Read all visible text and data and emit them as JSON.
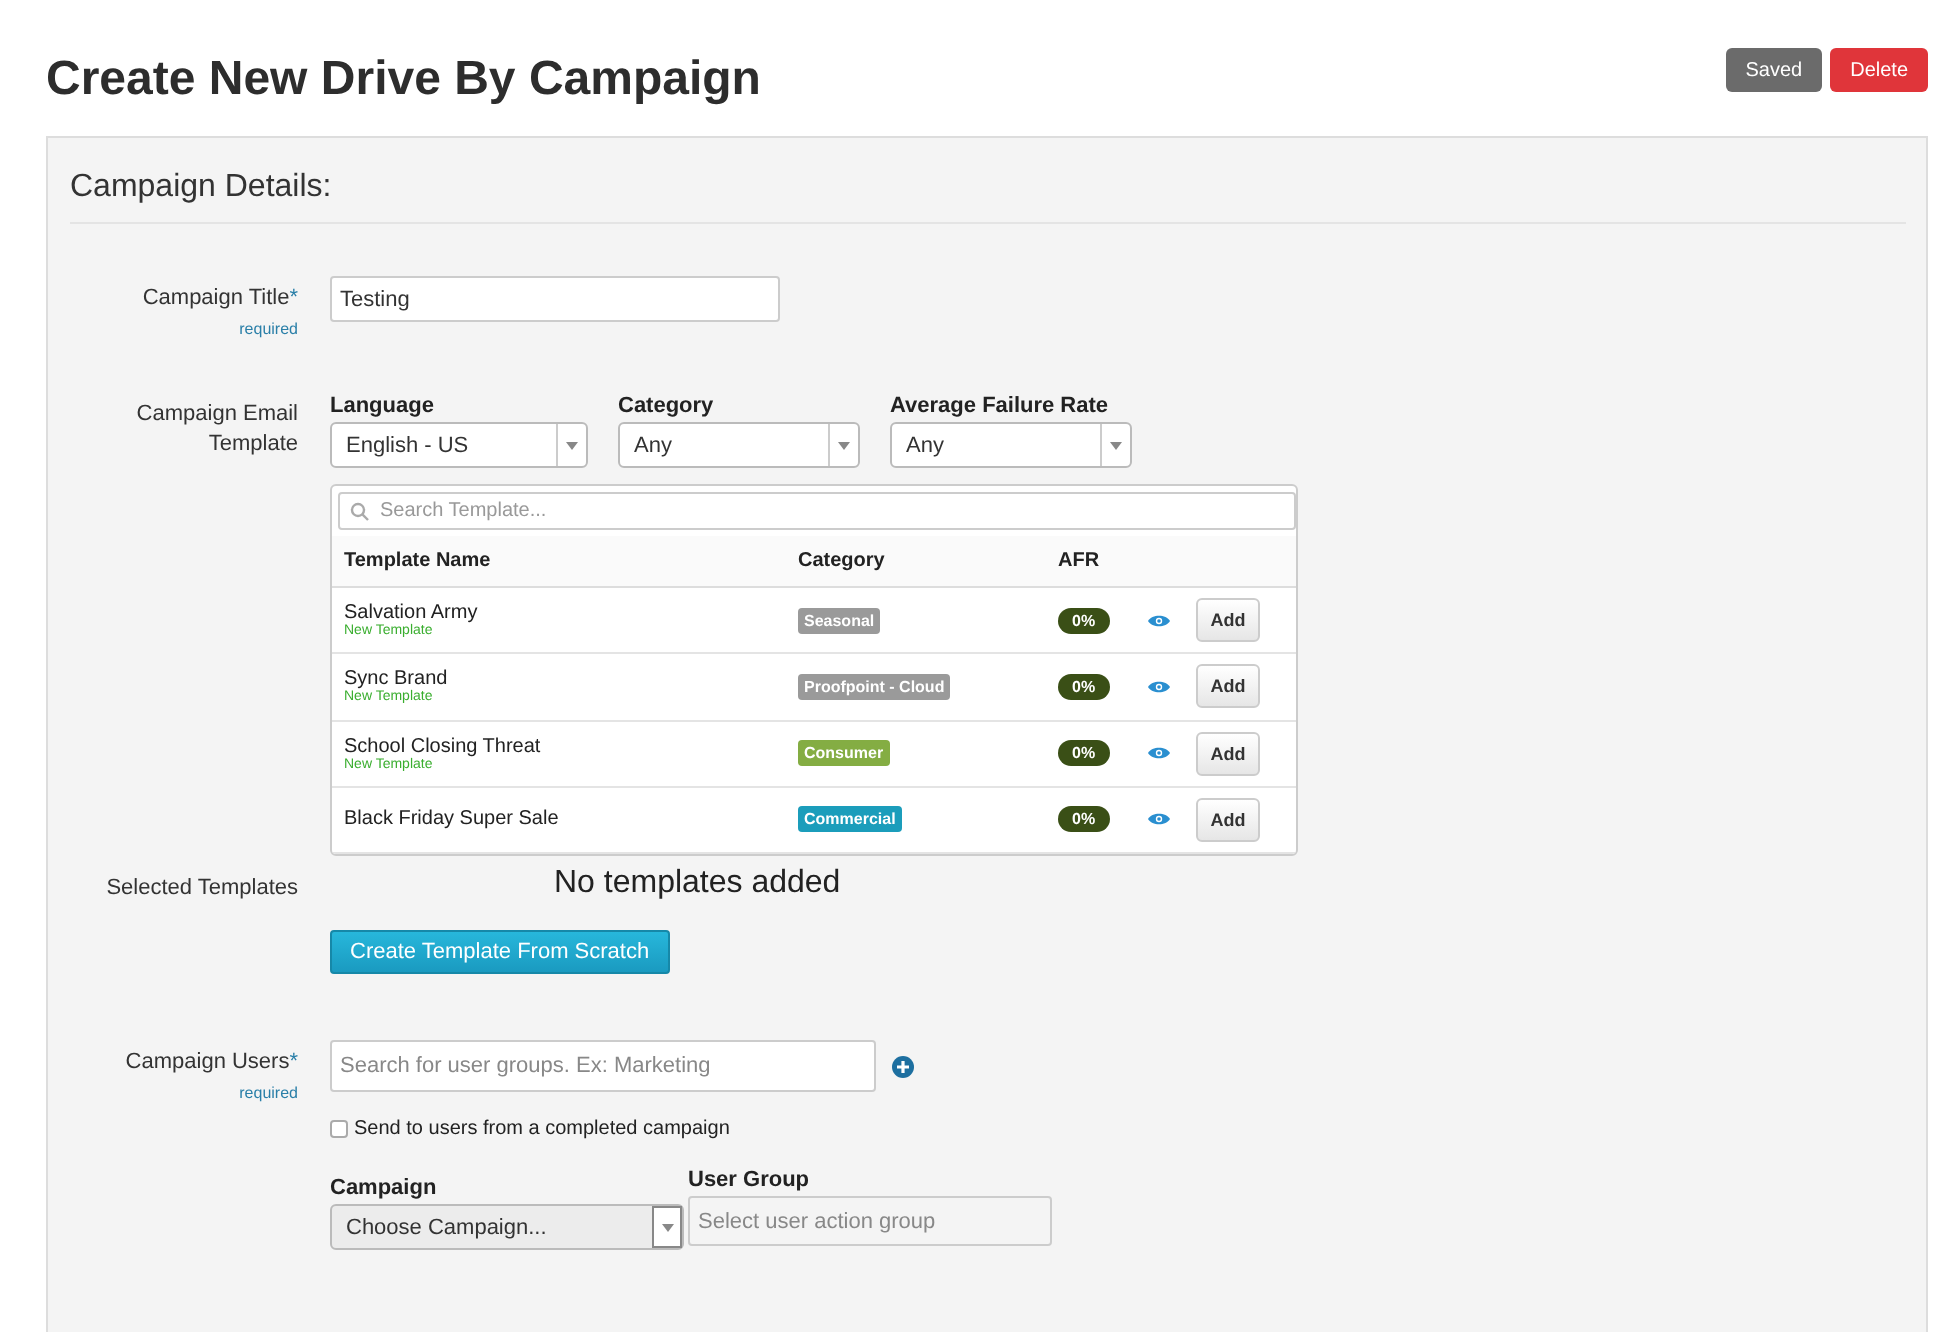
{
  "page_title": "Create New Drive By Campaign",
  "header_buttons": [
    {
      "label": "Saved",
      "kind": "secondary"
    },
    {
      "label": "Delete",
      "kind": "danger"
    }
  ],
  "section_title": "Campaign Details:",
  "campaign_title": {
    "label": "Campaign Title",
    "required_mark": "*",
    "hint": "required",
    "value": "Testing"
  },
  "email_template": {
    "label": "Campaign Email Template",
    "filters": [
      {
        "label": "Language",
        "value": "English - US"
      },
      {
        "label": "Category",
        "value": "Any"
      },
      {
        "label": "Average Failure Rate",
        "value": "Any"
      }
    ],
    "search": {
      "placeholder": "Search Template..."
    },
    "columns": [
      "Template Name",
      "Category",
      "AFR"
    ],
    "rows": [
      {
        "name": "Salvation Army",
        "subtitle": "New Template",
        "category": "Seasonal",
        "color": "#9a9a9a",
        "afr": "0%",
        "action": "Add"
      },
      {
        "name": "Sync Brand",
        "subtitle": "New Template",
        "category": "Proofpoint - Cloud",
        "color": "#9a9a9a",
        "afr": "0%",
        "action": "Add"
      },
      {
        "name": "School Closing Threat",
        "subtitle": "New Template",
        "category": "Consumer",
        "color": "#84ad43",
        "afr": "0%",
        "action": "Add"
      },
      {
        "name": "Black Friday Super Sale",
        "category": "Commercial",
        "color": "#1b9dbb",
        "afr": "0%",
        "action": "Add"
      }
    ]
  },
  "selected_templates": {
    "label": "Selected Templates",
    "empty_text": "No templates added",
    "button": "Create Template From Scratch"
  },
  "campaign_users": {
    "label": "Campaign Users",
    "required_mark": "*",
    "hint": "required",
    "placeholder": "Search for user groups. Ex: Marketing",
    "send_completed": {
      "label": "Send to users from a completed campaign",
      "checked": false
    },
    "campaign": {
      "label": "Campaign",
      "value": "Choose Campaign..."
    },
    "user_group": {
      "label": "User Group",
      "placeholder": "Select user action group"
    }
  }
}
